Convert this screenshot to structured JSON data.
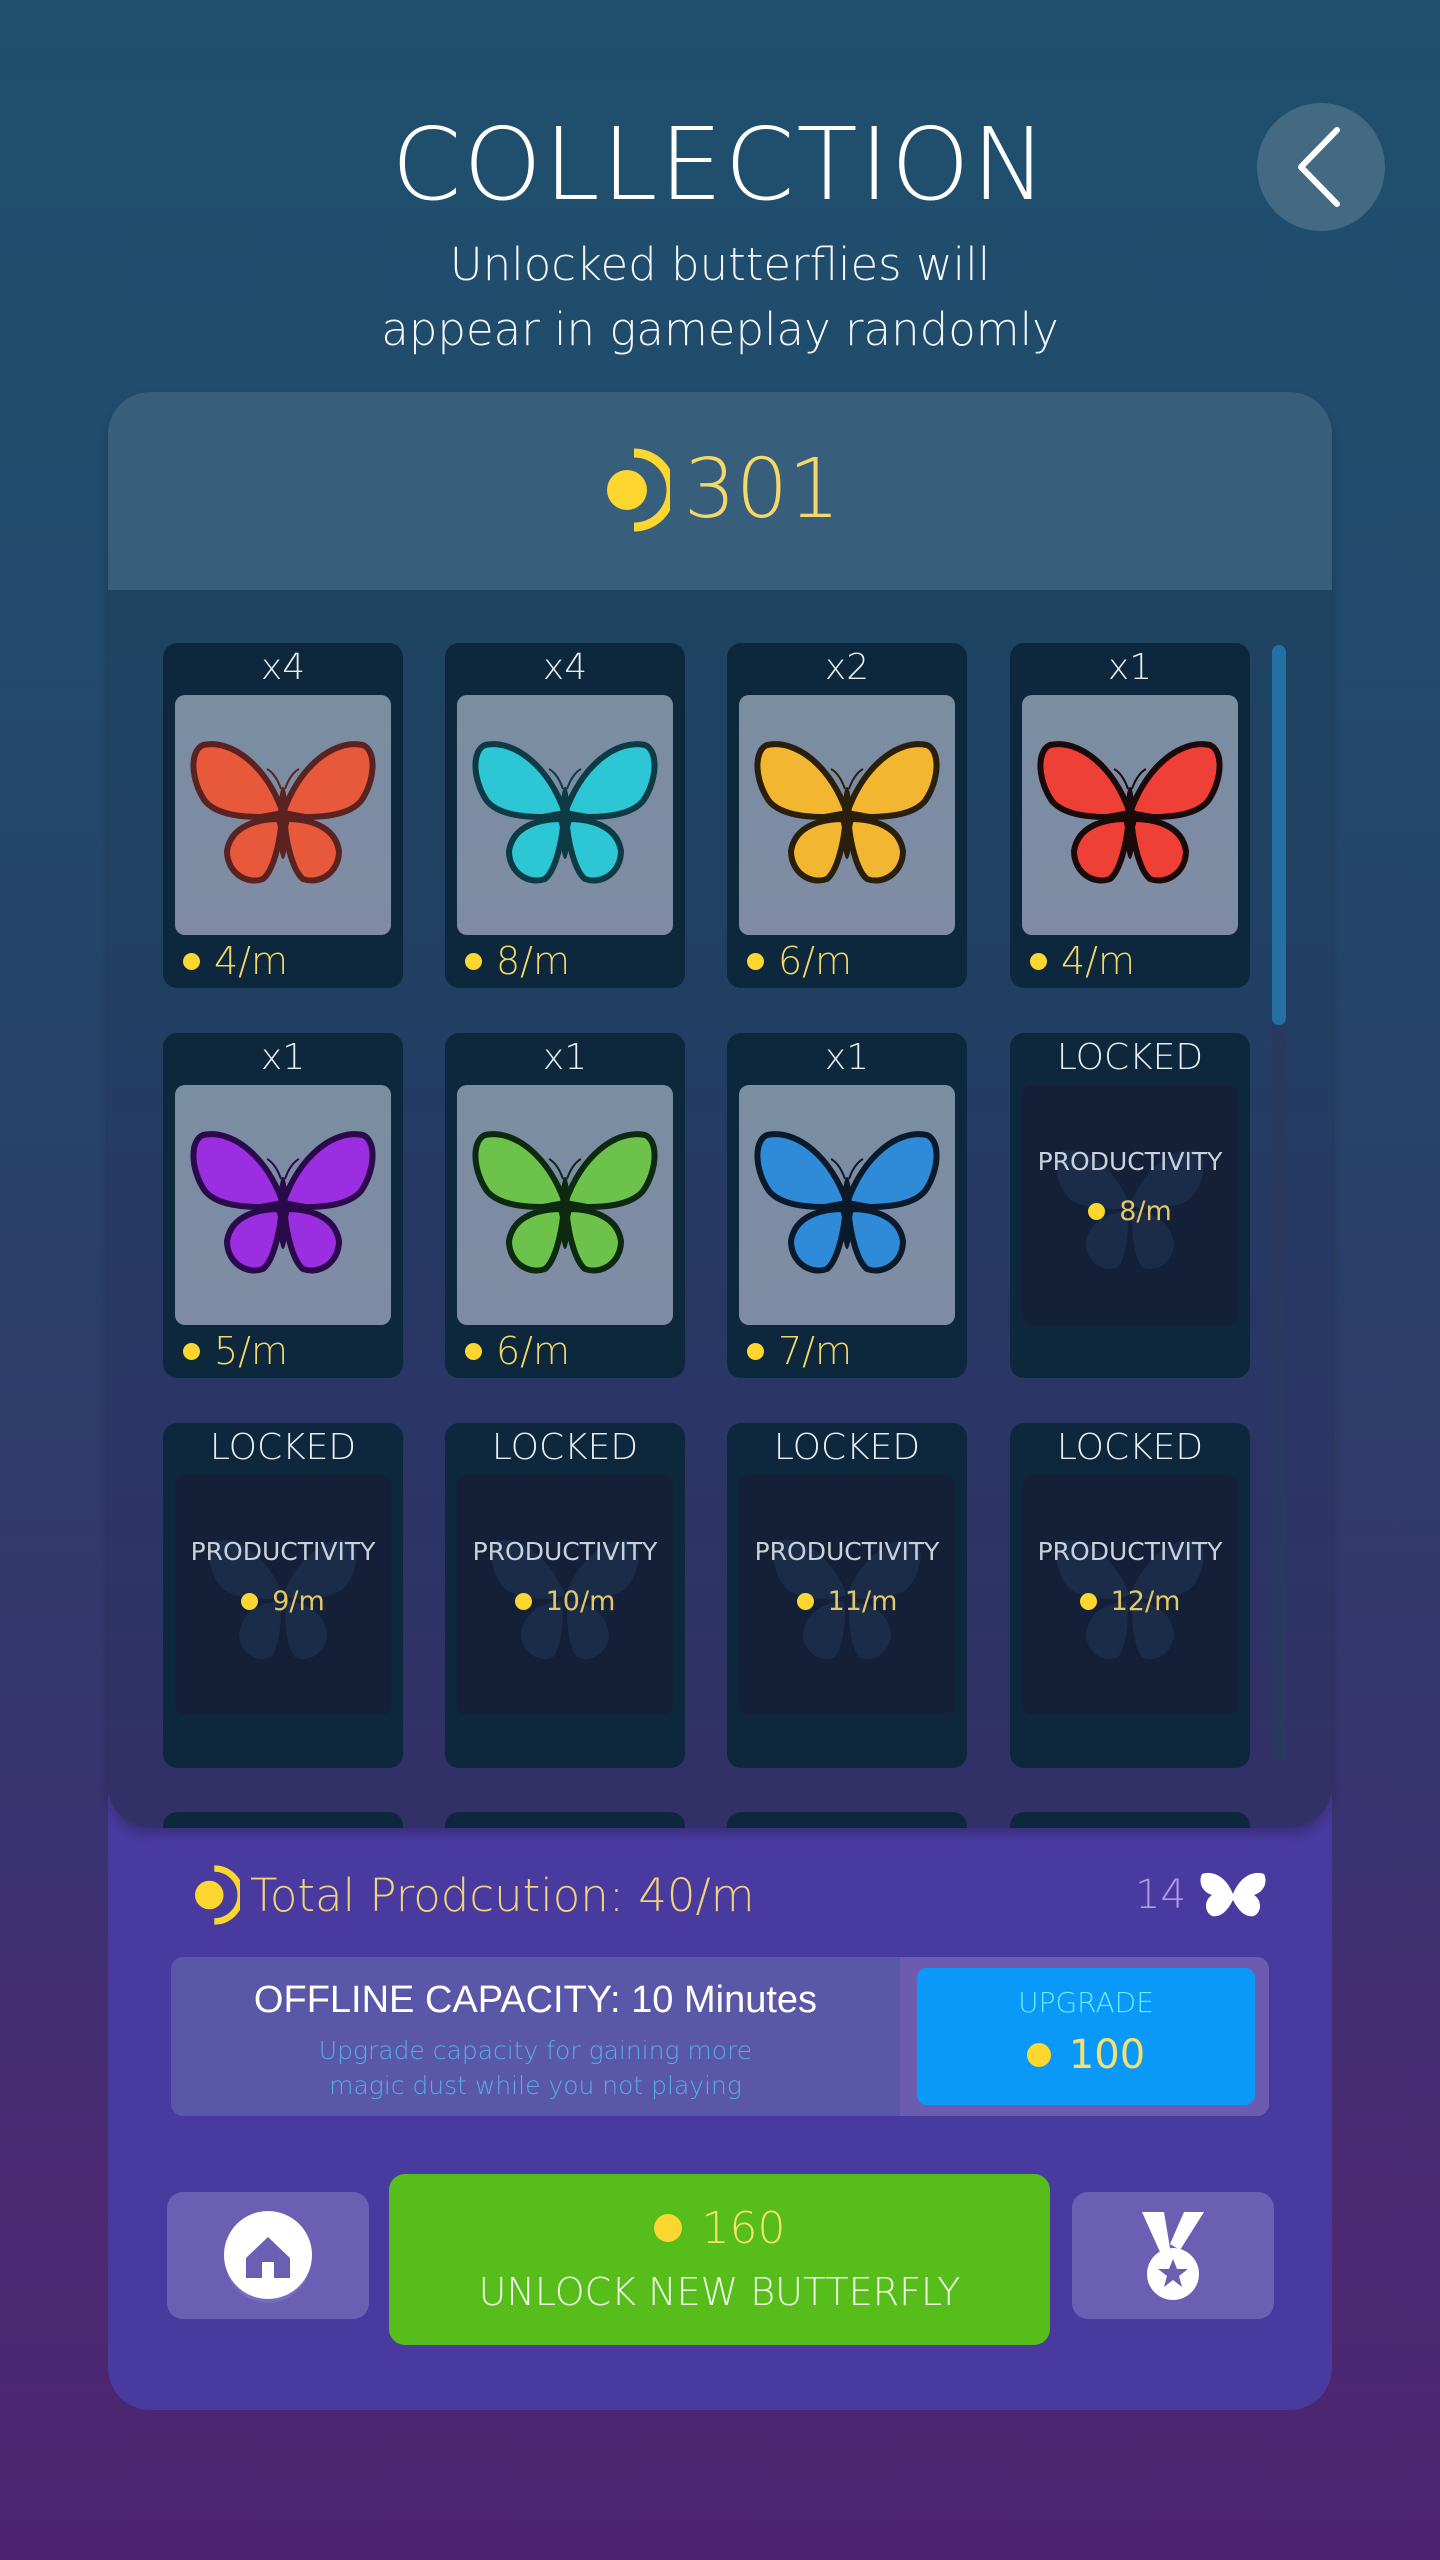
{
  "header": {
    "title": "COLLECTION",
    "subtitle_line1": "Unlocked butterflies will",
    "subtitle_line2": "appear in gameplay randomly",
    "back_icon": "chevron-left-icon"
  },
  "balance": {
    "icon": "magic-dust-icon",
    "value": "301"
  },
  "cards": [
    {
      "state": "unlocked",
      "count": "x4",
      "rate": "4/m",
      "butterfly": "orange-monarch",
      "color": "#e8583a",
      "accent": "#5a2220"
    },
    {
      "state": "unlocked",
      "count": "x4",
      "rate": "8/m",
      "butterfly": "cyan",
      "color": "#2cc6d4",
      "accent": "#0d3a44"
    },
    {
      "state": "unlocked",
      "count": "x2",
      "rate": "6/m",
      "butterfly": "yellow-swallowtail",
      "color": "#f2b630",
      "accent": "#2a1f0a"
    },
    {
      "state": "unlocked",
      "count": "x1",
      "rate": "4/m",
      "butterfly": "red",
      "color": "#ef4038",
      "accent": "#1a0a0a"
    },
    {
      "state": "unlocked",
      "count": "x1",
      "rate": "5/m",
      "butterfly": "purple-spotted",
      "color": "#9a2ee0",
      "accent": "#2a0a4a"
    },
    {
      "state": "unlocked",
      "count": "x1",
      "rate": "6/m",
      "butterfly": "green",
      "color": "#6cc24a",
      "accent": "#0d2a10"
    },
    {
      "state": "unlocked",
      "count": "x1",
      "rate": "7/m",
      "butterfly": "blue-morpho",
      "color": "#2f8ad8",
      "accent": "#0a1a2a"
    },
    {
      "state": "locked",
      "label": "LOCKED",
      "productivity_label": "PRODUCTIVITY",
      "rate": "8/m"
    },
    {
      "state": "locked",
      "label": "LOCKED",
      "productivity_label": "PRODUCTIVITY",
      "rate": "9/m"
    },
    {
      "state": "locked",
      "label": "LOCKED",
      "productivity_label": "PRODUCTIVITY",
      "rate": "10/m"
    },
    {
      "state": "locked",
      "label": "LOCKED",
      "productivity_label": "PRODUCTIVITY",
      "rate": "11/m"
    },
    {
      "state": "locked",
      "label": "LOCKED",
      "productivity_label": "PRODUCTIVITY",
      "rate": "12/m"
    }
  ],
  "stats": {
    "total_production": "Total Prodcution: 40/m",
    "butterfly_count": "14",
    "butterfly_icon": "butterfly-icon"
  },
  "offline": {
    "title": "OFFLINE CAPACITY: 10 Minutes",
    "desc_line1": "Upgrade capacity for gaining more",
    "desc_line2": "magic dust while you not playing",
    "upgrade_label": "UPGRADE",
    "upgrade_price": "100"
  },
  "actions": {
    "home_icon": "home-icon",
    "unlock_price": "160",
    "unlock_label": "UNLOCK NEW BUTTERFLY",
    "achievements_icon": "medal-icon"
  },
  "colors": {
    "coin": "#fdd630",
    "unlock_button": "#56bd1a",
    "upgrade_button": "#0a99f8",
    "panel": "#483a9e"
  }
}
